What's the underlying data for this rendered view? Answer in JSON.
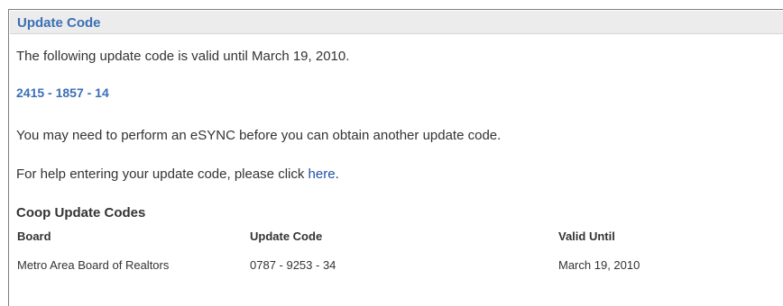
{
  "header": {
    "title": "Update Code"
  },
  "info": {
    "valid_text": "The following update code is valid until March 19, 2010.",
    "code": "2415 - 1857 - 14",
    "esync_text": "You may need to perform an eSYNC before you can obtain another update code.",
    "help_prefix": "For help entering your update code, please click ",
    "help_link": "here",
    "help_suffix": "."
  },
  "coop": {
    "title": "Coop Update Codes",
    "columns": [
      "Board",
      "Update Code",
      "Valid Until"
    ],
    "rows": [
      {
        "board": "Metro Area Board of Realtors",
        "code": "0787 - 9253 - 34",
        "valid_until": "March 19, 2010"
      }
    ]
  }
}
